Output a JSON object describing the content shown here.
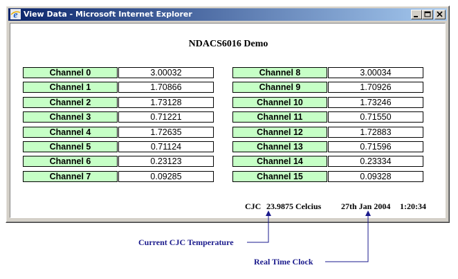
{
  "window": {
    "title": "View Data - Microsoft Internet Explorer",
    "icon": "internet-explorer-icon",
    "controls": [
      "minimize-icon",
      "maximize-icon",
      "close-icon"
    ]
  },
  "page": {
    "title": "NDACS6016 Demo"
  },
  "channels_left": [
    {
      "label": "Channel 0",
      "value": "3.00032"
    },
    {
      "label": "Channel 1",
      "value": "1.70866"
    },
    {
      "label": "Channel 2",
      "value": "1.73128"
    },
    {
      "label": "Channel 3",
      "value": "0.71221"
    },
    {
      "label": "Channel 4",
      "value": "1.72635"
    },
    {
      "label": "Channel 5",
      "value": "0.71124"
    },
    {
      "label": "Channel 6",
      "value": "0.23123"
    },
    {
      "label": "Channel 7",
      "value": "0.09285"
    }
  ],
  "channels_right": [
    {
      "label": "Channel 8",
      "value": "3.00034"
    },
    {
      "label": "Channel 9",
      "value": "1.70926"
    },
    {
      "label": "Channel 10",
      "value": "1.73246"
    },
    {
      "label": "Channel 11",
      "value": "0.71550"
    },
    {
      "label": "Channel 12",
      "value": "1.72883"
    },
    {
      "label": "Channel 13",
      "value": "0.71596"
    },
    {
      "label": "Channel 14",
      "value": "0.23334"
    },
    {
      "label": "Channel 15",
      "value": "0.09328"
    }
  ],
  "status": {
    "cjc_label": "CJC",
    "cjc_value": "23.9875 Celcius",
    "date": "27th Jan 2004",
    "time": "1:20:34"
  },
  "annotations": {
    "cjc": "Current CJC Temperature",
    "clock": "Real Time Clock"
  },
  "colors": {
    "label_bg": "#c6ffc6",
    "annotation": "#1a1a8c",
    "titlebar_start": "#0a246a",
    "titlebar_end": "#a6caf0"
  }
}
